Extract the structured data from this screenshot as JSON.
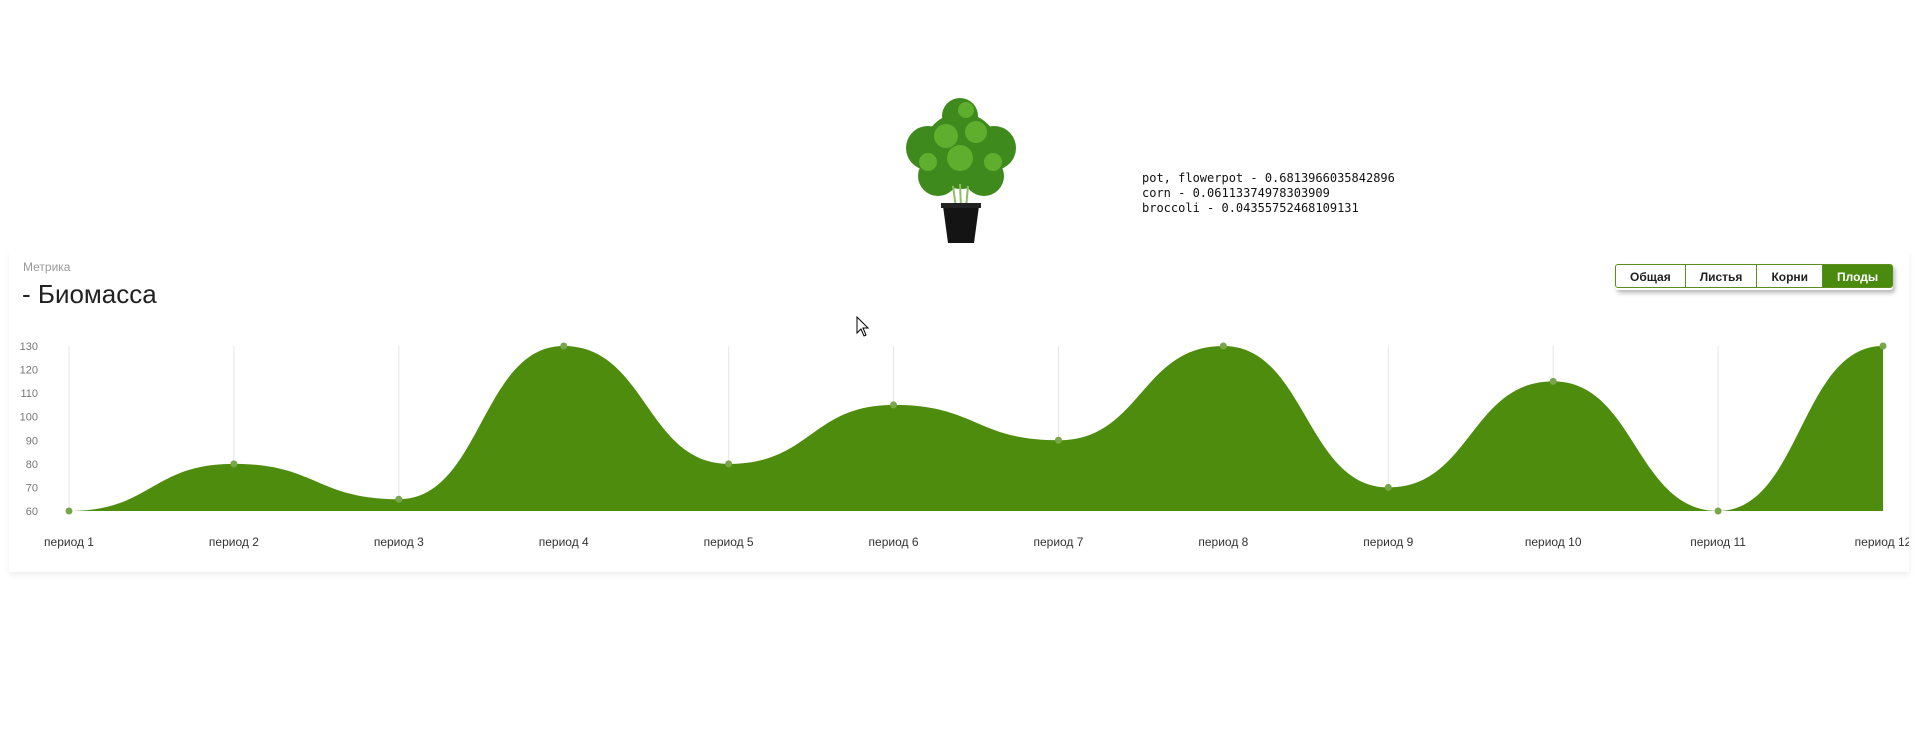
{
  "predictions": [
    "pot, flowerpot - 0.6813966035842896",
    "corn - 0.06113374978303909",
    "broccoli - 0.04355752468109131"
  ],
  "metric": {
    "label": "Метрика",
    "title": "- Биомасса"
  },
  "tabs": [
    {
      "label": "Общая",
      "active": false
    },
    {
      "label": "Листья",
      "active": false
    },
    {
      "label": "Корни",
      "active": false
    },
    {
      "label": "Плоды",
      "active": true
    }
  ],
  "colors": {
    "area": "#4e8c0e",
    "point": "#79a64a",
    "accent": "#4a8b0f"
  },
  "chart_data": {
    "type": "area",
    "categories": [
      "период 1",
      "период 2",
      "период 3",
      "период 4",
      "период 5",
      "период 6",
      "период 7",
      "период 8",
      "период 9",
      "период 10",
      "период 11",
      "период 12"
    ],
    "values": [
      60,
      80,
      65,
      130,
      80,
      105,
      90,
      130,
      70,
      115,
      60,
      130
    ],
    "yticks": [
      60,
      70,
      80,
      90,
      100,
      110,
      120,
      130
    ],
    "ylim": [
      60,
      130
    ],
    "grid": "vertical"
  }
}
